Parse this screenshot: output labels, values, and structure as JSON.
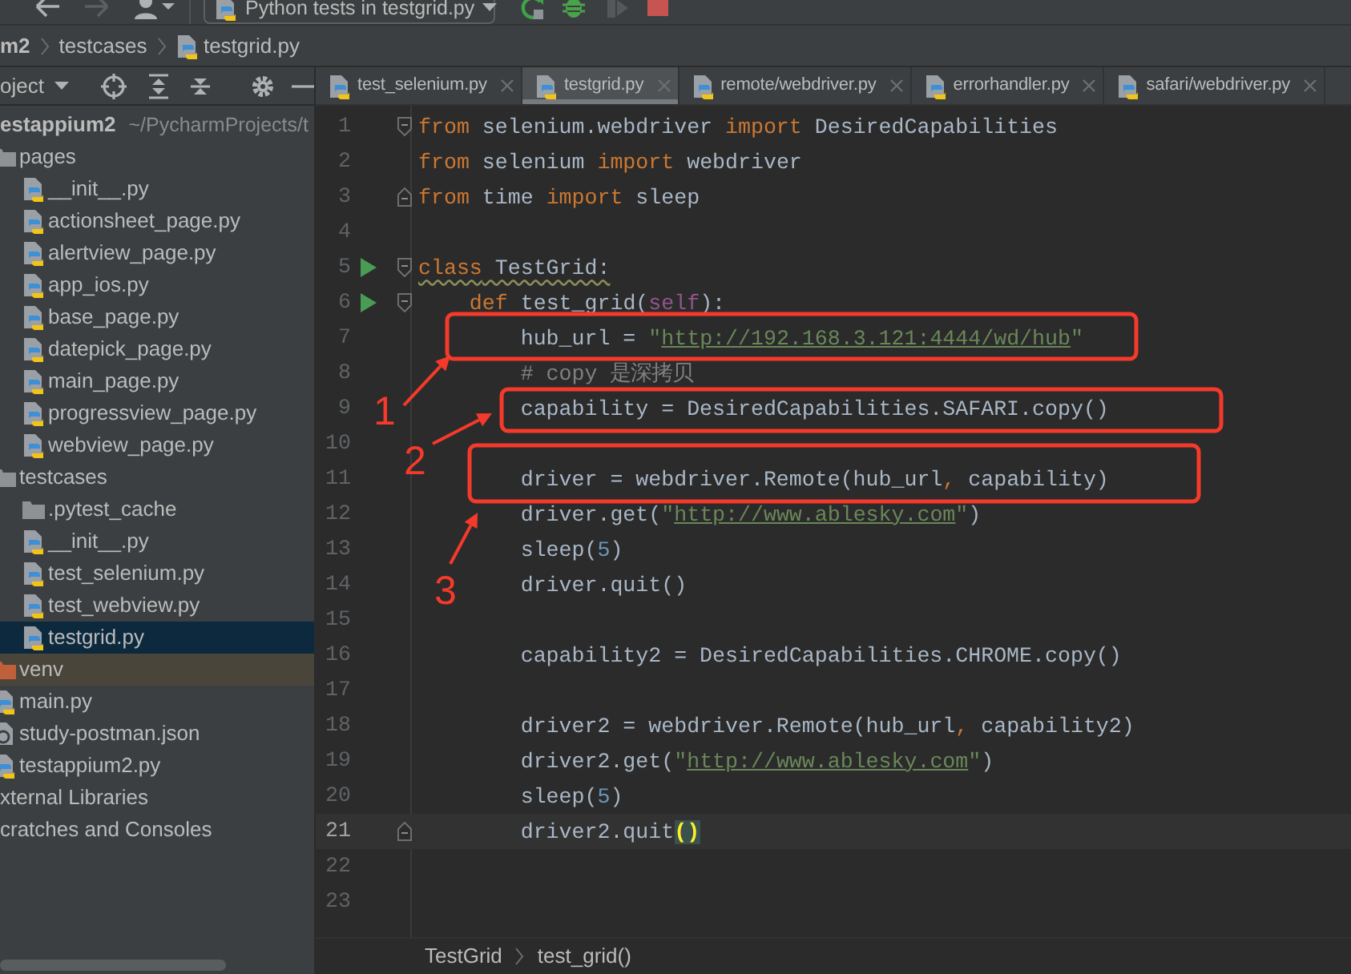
{
  "toolbar": {
    "nav_buttons": [
      {
        "kind": "back",
        "disabled": false
      },
      {
        "kind": "forward",
        "disabled": true
      },
      {
        "kind": "user",
        "disabled": false
      }
    ],
    "run_config": "Python tests in testgrid.py",
    "actions": [
      {
        "kind": "rerun",
        "disabled": false
      },
      {
        "kind": "debug",
        "disabled": false
      },
      {
        "kind": "coverage",
        "disabled": true
      },
      {
        "kind": "stop",
        "disabled": false
      }
    ]
  },
  "navigation_bar": [
    {
      "label": "m2",
      "kind": "project"
    },
    {
      "label": "testcases",
      "kind": "folder"
    },
    {
      "label": "testgrid.py",
      "kind": "python"
    }
  ],
  "project_panel": {
    "title": "oject",
    "tree": [
      {
        "label": "estappium2",
        "path": "~/PycharmProjects/t",
        "kind": "project",
        "selected": false,
        "children": [
          {
            "label": "pages",
            "kind": "folder",
            "selected": false,
            "children": [
              {
                "label": "__init__.py",
                "kind": "python",
                "selected": false
              },
              {
                "label": "actionsheet_page.py",
                "kind": "python",
                "selected": false
              },
              {
                "label": "alertview_page.py",
                "kind": "python",
                "selected": false
              },
              {
                "label": "app_ios.py",
                "kind": "python",
                "selected": false
              },
              {
                "label": "base_page.py",
                "kind": "python",
                "selected": false
              },
              {
                "label": "datepick_page.py",
                "kind": "python",
                "selected": false
              },
              {
                "label": "main_page.py",
                "kind": "python",
                "selected": false
              },
              {
                "label": "progressview_page.py",
                "kind": "python",
                "selected": false
              },
              {
                "label": "webview_page.py",
                "kind": "python",
                "selected": false
              }
            ]
          },
          {
            "label": "testcases",
            "kind": "folder",
            "selected": false,
            "children": [
              {
                "label": ".pytest_cache",
                "kind": "folder",
                "selected": false
              },
              {
                "label": "__init__.py",
                "kind": "python",
                "selected": false
              },
              {
                "label": "test_selenium.py",
                "kind": "python",
                "selected": false
              },
              {
                "label": "test_webview.py",
                "kind": "python",
                "selected": false
              },
              {
                "label": "testgrid.py",
                "kind": "python",
                "selected": true
              }
            ]
          },
          {
            "label": "venv",
            "kind": "excluded-folder",
            "selected": false
          },
          {
            "label": "main.py",
            "kind": "python",
            "selected": false
          },
          {
            "label": "study-postman.json",
            "kind": "json",
            "selected": false
          },
          {
            "label": "testappium2.py",
            "kind": "python",
            "selected": false
          }
        ]
      },
      {
        "label": "xternal Libraries",
        "kind": "libraries",
        "selected": false
      },
      {
        "label": "cratches and Consoles",
        "kind": "scratches",
        "selected": false
      }
    ]
  },
  "tabs": [
    {
      "label": "test_selenium.py",
      "selected": false
    },
    {
      "label": "testgrid.py",
      "selected": true
    },
    {
      "label": "remote/webdriver.py",
      "selected": false
    },
    {
      "label": "errorhandler.py",
      "selected": false
    },
    {
      "label": "safari/webdriver.py",
      "selected": false
    }
  ],
  "editor": {
    "lines": [
      {
        "number": "1",
        "run": false,
        "fold": {
          "kind": "start"
        },
        "current": false,
        "tokens": [
          {
            "text": "from",
            "kind": "keyword"
          },
          {
            "text": " selenium.webdriver ",
            "kind": "plain"
          },
          {
            "text": "import",
            "kind": "keyword"
          },
          {
            "text": " DesiredCapabilities",
            "kind": "plain"
          }
        ]
      },
      {
        "number": "2",
        "run": false,
        "current": false,
        "tokens": [
          {
            "text": "from",
            "kind": "keyword"
          },
          {
            "text": " selenium ",
            "kind": "plain"
          },
          {
            "text": "import",
            "kind": "keyword"
          },
          {
            "text": " webdriver",
            "kind": "plain"
          }
        ]
      },
      {
        "number": "3",
        "run": false,
        "fold": {
          "kind": "end"
        },
        "current": false,
        "tokens": [
          {
            "text": "from",
            "kind": "keyword"
          },
          {
            "text": " time ",
            "kind": "plain"
          },
          {
            "text": "import",
            "kind": "keyword"
          },
          {
            "text": " sleep",
            "kind": "plain"
          }
        ]
      },
      {
        "number": "4",
        "run": false,
        "current": false
      },
      {
        "number": "5",
        "run": true,
        "fold": {
          "kind": "start"
        },
        "current": false,
        "tokens": [
          {
            "text": "class",
            "kind": "keyword-warning"
          },
          {
            "text": " TestGrid:",
            "kind": "plain-warning"
          }
        ]
      },
      {
        "number": "6",
        "run": true,
        "fold": {
          "kind": "start"
        },
        "current": false,
        "tokens": [
          {
            "text": "    def",
            "kind": "keyword"
          },
          {
            "text": " test_grid(",
            "kind": "plain"
          },
          {
            "text": "self",
            "kind": "self"
          },
          {
            "text": "):",
            "kind": "plain"
          }
        ]
      },
      {
        "number": "7",
        "run": false,
        "current": false,
        "tokens": [
          {
            "text": "        hub_url = ",
            "kind": "plain"
          },
          {
            "text": "\"",
            "kind": "string"
          },
          {
            "text": "http://192.168.3.121:4444/wd/hub",
            "kind": "url"
          },
          {
            "text": "\"",
            "kind": "string"
          }
        ]
      },
      {
        "number": "8",
        "run": false,
        "current": false,
        "tokens": [
          {
            "text": "        # copy 是深拷贝",
            "kind": "comment"
          }
        ]
      },
      {
        "number": "9",
        "run": false,
        "current": false,
        "tokens": [
          {
            "text": "        capability = DesiredCapabilities.SAFARI.copy()",
            "kind": "plain"
          }
        ]
      },
      {
        "number": "10",
        "run": false,
        "current": false
      },
      {
        "number": "11",
        "run": false,
        "current": false,
        "tokens": [
          {
            "text": "        driver = webdriver.Remote(hub_url",
            "kind": "plain"
          },
          {
            "text": ",",
            "kind": "operator"
          },
          {
            "text": " capability)",
            "kind": "plain"
          }
        ]
      },
      {
        "number": "12",
        "run": false,
        "current": false,
        "tokens": [
          {
            "text": "        driver.get(",
            "kind": "plain"
          },
          {
            "text": "\"",
            "kind": "string"
          },
          {
            "text": "http://www.ablesky.com",
            "kind": "url"
          },
          {
            "text": "\"",
            "kind": "string"
          },
          {
            "text": ")",
            "kind": "plain"
          }
        ]
      },
      {
        "number": "13",
        "run": false,
        "current": false,
        "tokens": [
          {
            "text": "        sleep(",
            "kind": "plain"
          },
          {
            "text": "5",
            "kind": "number"
          },
          {
            "text": ")",
            "kind": "plain"
          }
        ]
      },
      {
        "number": "14",
        "run": false,
        "current": false,
        "tokens": [
          {
            "text": "        driver.quit()",
            "kind": "plain"
          }
        ]
      },
      {
        "number": "15",
        "run": false,
        "current": false
      },
      {
        "number": "16",
        "run": false,
        "current": false,
        "tokens": [
          {
            "text": "        capability2 = DesiredCapabilities.CHROME.copy()",
            "kind": "plain"
          }
        ]
      },
      {
        "number": "17",
        "run": false,
        "current": false
      },
      {
        "number": "18",
        "run": false,
        "current": false,
        "tokens": [
          {
            "text": "        driver2 = webdriver.Remote(hub_url",
            "kind": "plain"
          },
          {
            "text": ",",
            "kind": "operator"
          },
          {
            "text": " capability2)",
            "kind": "plain"
          }
        ]
      },
      {
        "number": "19",
        "run": false,
        "current": false,
        "tokens": [
          {
            "text": "        driver2.get(",
            "kind": "plain"
          },
          {
            "text": "\"",
            "kind": "string"
          },
          {
            "text": "http://www.ablesky.com",
            "kind": "url"
          },
          {
            "text": "\"",
            "kind": "string"
          },
          {
            "text": ")",
            "kind": "plain"
          }
        ]
      },
      {
        "number": "20",
        "run": false,
        "current": false,
        "tokens": [
          {
            "text": "        sleep(",
            "kind": "plain"
          },
          {
            "text": "5",
            "kind": "number"
          },
          {
            "text": ")",
            "kind": "plain"
          }
        ]
      },
      {
        "number": "21",
        "run": false,
        "fold": {
          "kind": "end"
        },
        "current": true,
        "tokens": [
          {
            "text": "        driver2.quit",
            "kind": "plain"
          },
          {
            "text": "()",
            "kind": "brace-match"
          }
        ]
      },
      {
        "number": "22",
        "run": false,
        "current": false
      },
      {
        "number": "23",
        "run": false,
        "current": false
      }
    ]
  },
  "breadcrumbs": [
    "TestGrid",
    "test_grid()"
  ],
  "annotations": [
    {
      "number": "1"
    },
    {
      "number": "2"
    },
    {
      "number": "3"
    }
  ]
}
